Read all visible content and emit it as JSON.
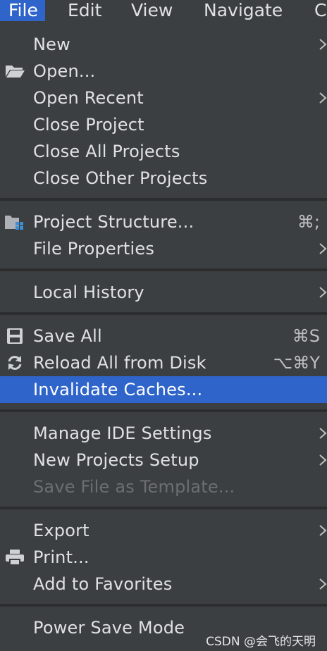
{
  "menubar": {
    "file": "File",
    "edit": "Edit",
    "view": "View",
    "navigate": "Navigate",
    "code": "C"
  },
  "menu": {
    "new": "New",
    "open": "Open...",
    "open_recent": "Open Recent",
    "close_project": "Close Project",
    "close_all_projects": "Close All Projects",
    "close_other_projects": "Close Other Projects",
    "project_structure": "Project Structure...",
    "project_structure_shortcut": "⌘;",
    "file_properties": "File Properties",
    "local_history": "Local History",
    "save_all": "Save All",
    "save_all_shortcut": "⌘S",
    "reload_all": "Reload All from Disk",
    "reload_all_shortcut": "⌥⌘Y",
    "invalidate_caches": "Invalidate Caches...",
    "manage_ide_settings": "Manage IDE Settings",
    "new_projects_setup": "New Projects Setup",
    "save_file_as_template": "Save File as Template...",
    "export": "Export",
    "print": "Print...",
    "add_to_favorites": "Add to Favorites",
    "power_save_mode": "Power Save Mode"
  },
  "icons": {
    "open": "folder-open-icon",
    "project_structure": "project-structure-icon",
    "save_all": "save-icon",
    "reload_all": "reload-icon",
    "print": "printer-icon",
    "submenu": "chevron-right-icon"
  },
  "colors": {
    "background": "#3c3f41",
    "selection": "#2f65ca",
    "text": "#dfe1e5",
    "disabled_text": "#6c6f72",
    "separator": "#2b2d2f"
  },
  "watermark": "CSDN @会飞的天明"
}
